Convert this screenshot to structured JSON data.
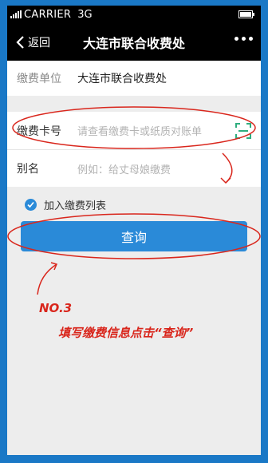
{
  "status_bar": {
    "carrier": "CARRIER",
    "network": "3G"
  },
  "nav": {
    "back_label": "返回",
    "title": "大连市联合收费处"
  },
  "form": {
    "unit_label": "缴费单位",
    "unit_value": "大连市联合收费处",
    "card_label": "缴费卡号",
    "card_placeholder": "请查看缴费卡或纸质对账单",
    "alias_label": "别名",
    "alias_placeholder": "例如：给丈母娘缴费",
    "add_to_list_label": "加入缴费列表",
    "add_to_list_checked": true
  },
  "query_button_label": "查询",
  "annotation": {
    "step": "NO.3",
    "text": "填写缴费信息点击“查询”",
    "color": "#d9261c"
  },
  "colors": {
    "accent": "#2a8ad8",
    "background": "#1a78c6",
    "navbar": "#000000"
  }
}
